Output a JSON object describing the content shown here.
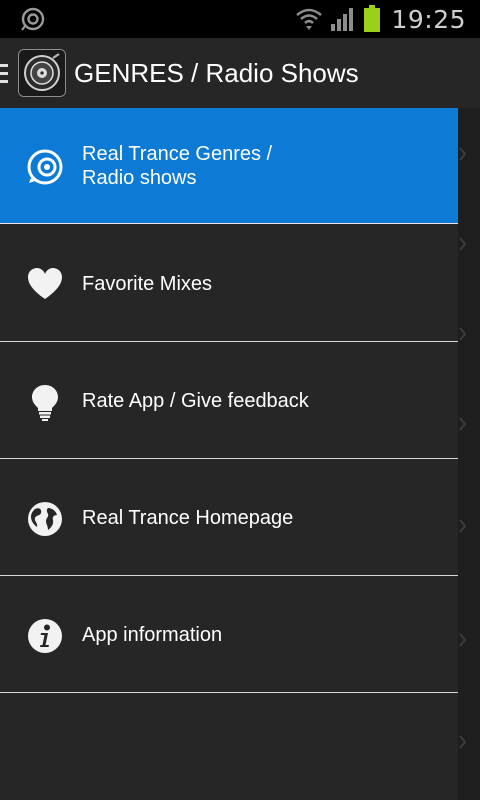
{
  "status_bar": {
    "time": "19:25",
    "left_icon": "radio-notification-icon",
    "wifi_icon": "wifi-icon",
    "signal_icon": "signal-icon",
    "battery_icon": "battery-icon",
    "battery_color": "#9ccf19"
  },
  "action_bar": {
    "drawer_icon": "drawer-toggle-icon",
    "logo_icon": "app-logo-icon",
    "title": "GENRES / Radio Shows"
  },
  "drawer": {
    "accent_color": "#0d7bd6",
    "items": [
      {
        "label": "Real Trance Genres / Radio shows",
        "icon": "speaker-icon",
        "selected": true
      },
      {
        "label": "Favorite Mixes",
        "icon": "heart-icon",
        "selected": false
      },
      {
        "label": "Rate App / Give feedback",
        "icon": "lightbulb-icon",
        "selected": false
      },
      {
        "label": "Real Trance Homepage",
        "icon": "globe-icon",
        "selected": false
      },
      {
        "label": "App information",
        "icon": "info-icon",
        "selected": false
      }
    ]
  }
}
